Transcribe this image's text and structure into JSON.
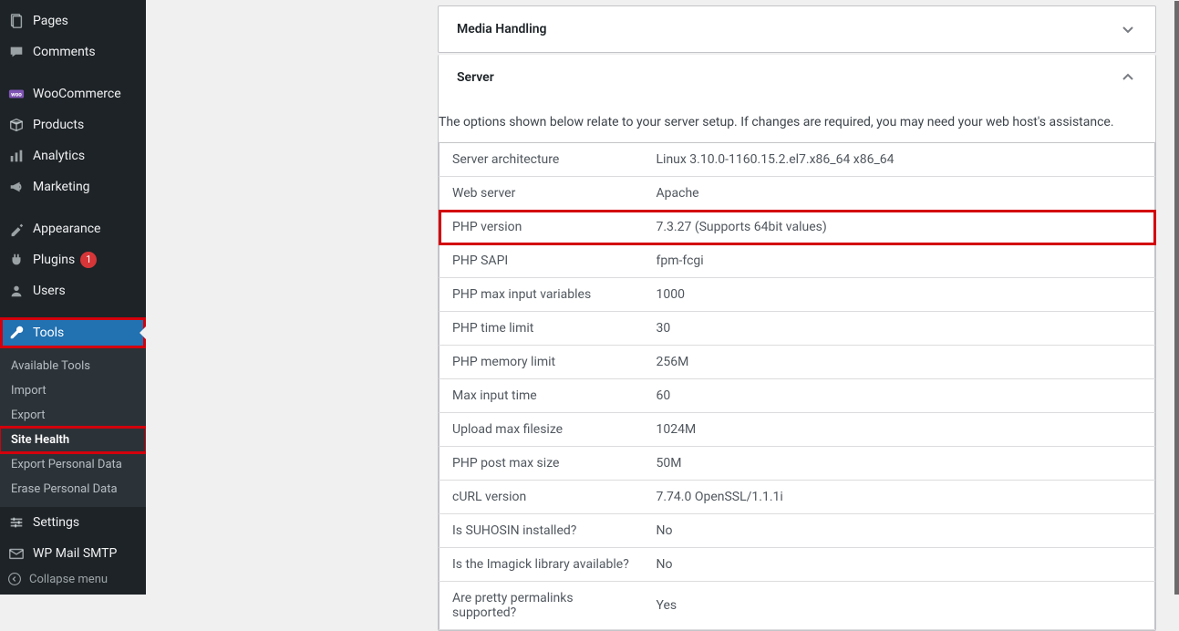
{
  "sidebar": {
    "items": [
      {
        "id": "pages",
        "label": "Pages",
        "icon": "pages-icon"
      },
      {
        "id": "comments",
        "label": "Comments",
        "icon": "comment-icon"
      },
      {
        "id": "woocommerce",
        "label": "WooCommerce",
        "icon": "woo-icon"
      },
      {
        "id": "products",
        "label": "Products",
        "icon": "products-icon"
      },
      {
        "id": "analytics",
        "label": "Analytics",
        "icon": "analytics-icon"
      },
      {
        "id": "marketing",
        "label": "Marketing",
        "icon": "marketing-icon"
      },
      {
        "id": "appearance",
        "label": "Appearance",
        "icon": "appearance-icon"
      },
      {
        "id": "plugins",
        "label": "Plugins",
        "icon": "plugins-icon",
        "badge": "1"
      },
      {
        "id": "users",
        "label": "Users",
        "icon": "users-icon"
      },
      {
        "id": "tools",
        "label": "Tools",
        "icon": "tools-icon",
        "current": true,
        "highlight": true
      },
      {
        "id": "settings",
        "label": "Settings",
        "icon": "settings-icon"
      },
      {
        "id": "wpmailsmtp",
        "label": "WP Mail SMTP",
        "icon": "mail-icon"
      }
    ],
    "tools_submenu": [
      {
        "id": "available-tools",
        "label": "Available Tools"
      },
      {
        "id": "import",
        "label": "Import"
      },
      {
        "id": "export",
        "label": "Export"
      },
      {
        "id": "site-health",
        "label": "Site Health",
        "current": true,
        "highlight": true
      },
      {
        "id": "export-personal-data",
        "label": "Export Personal Data"
      },
      {
        "id": "erase-personal-data",
        "label": "Erase Personal Data"
      }
    ],
    "collapse_label": "Collapse menu"
  },
  "panels": {
    "media": {
      "title": "Media Handling",
      "expanded": false
    },
    "server": {
      "title": "Server",
      "expanded": true,
      "description": "The options shown below relate to your server setup. If changes are required, you may need your web host's assistance.",
      "rows": [
        {
          "label": "Server architecture",
          "value": "Linux 3.10.0-1160.15.2.el7.x86_64 x86_64"
        },
        {
          "label": "Web server",
          "value": "Apache"
        },
        {
          "label": "PHP version",
          "value": "7.3.27 (Supports 64bit values)",
          "highlight": true
        },
        {
          "label": "PHP SAPI",
          "value": "fpm-fcgi"
        },
        {
          "label": "PHP max input variables",
          "value": "1000"
        },
        {
          "label": "PHP time limit",
          "value": "30"
        },
        {
          "label": "PHP memory limit",
          "value": "256M"
        },
        {
          "label": "Max input time",
          "value": "60"
        },
        {
          "label": "Upload max filesize",
          "value": "1024M"
        },
        {
          "label": "PHP post max size",
          "value": "50M"
        },
        {
          "label": "cURL version",
          "value": "7.74.0 OpenSSL/1.1.1i"
        },
        {
          "label": "Is SUHOSIN installed?",
          "value": "No"
        },
        {
          "label": "Is the Imagick library available?",
          "value": "No"
        },
        {
          "label": "Are pretty permalinks supported?",
          "value": "Yes"
        }
      ]
    }
  }
}
